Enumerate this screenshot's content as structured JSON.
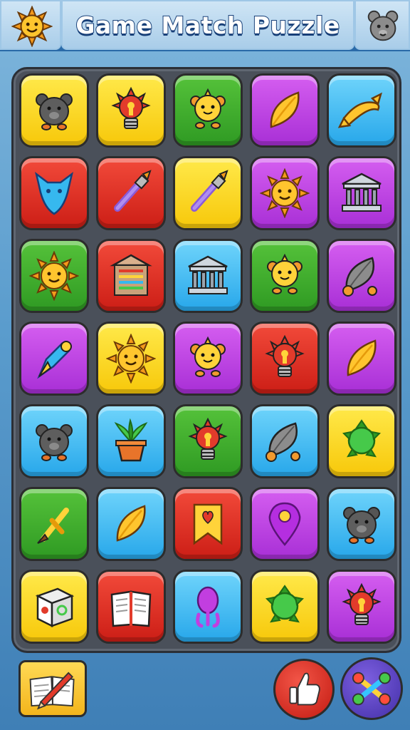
{
  "header": {
    "title": "Game Match Puzzle",
    "left_icon": "sun-face-icon",
    "right_icon": "bear-face-icon"
  },
  "board": {
    "rows": 7,
    "columns": 5,
    "tiles": [
      [
        {
          "color": "yellow",
          "icon": "bear-icon"
        },
        {
          "color": "yellow",
          "icon": "lightbulb-icon"
        },
        {
          "color": "green",
          "icon": "critter-icon"
        },
        {
          "color": "purple",
          "icon": "leaf-icon"
        },
        {
          "color": "blue",
          "icon": "ribbon-icon"
        }
      ],
      [
        {
          "color": "red",
          "icon": "fox-head-icon"
        },
        {
          "color": "red",
          "icon": "brush-icon"
        },
        {
          "color": "yellow",
          "icon": "brush-icon"
        },
        {
          "color": "purple",
          "icon": "sun-icon"
        },
        {
          "color": "purple",
          "icon": "temple-icon"
        }
      ],
      [
        {
          "color": "green",
          "icon": "sun-icon"
        },
        {
          "color": "red",
          "icon": "abacus-temple-icon"
        },
        {
          "color": "blue",
          "icon": "temple-icon"
        },
        {
          "color": "green",
          "icon": "critter-icon"
        },
        {
          "color": "purple",
          "icon": "feather-icon"
        }
      ],
      [
        {
          "color": "purple",
          "icon": "pen-nib-icon"
        },
        {
          "color": "yellow",
          "icon": "sun-icon"
        },
        {
          "color": "purple",
          "icon": "critter-icon"
        },
        {
          "color": "red",
          "icon": "lightbulb-icon"
        },
        {
          "color": "purple",
          "icon": "leaf-icon"
        }
      ],
      [
        {
          "color": "blue",
          "icon": "bear-icon"
        },
        {
          "color": "blue",
          "icon": "potted-plant-icon"
        },
        {
          "color": "green",
          "icon": "lightbulb-icon"
        },
        {
          "color": "blue",
          "icon": "feather-icon"
        },
        {
          "color": "yellow",
          "icon": "turtle-icon"
        }
      ],
      [
        {
          "color": "green",
          "icon": "sword-icon"
        },
        {
          "color": "blue",
          "icon": "leaf-icon"
        },
        {
          "color": "red",
          "icon": "bookmark-icon"
        },
        {
          "color": "purple",
          "icon": "map-pin-icon"
        },
        {
          "color": "blue",
          "icon": "bear-icon"
        }
      ],
      [
        {
          "color": "yellow",
          "icon": "dice-icon"
        },
        {
          "color": "red",
          "icon": "open-book-icon"
        },
        {
          "color": "blue",
          "icon": "balloon-icon"
        },
        {
          "color": "yellow",
          "icon": "turtle-icon"
        },
        {
          "color": "purple",
          "icon": "lightbulb-icon"
        }
      ]
    ]
  },
  "controls": {
    "book_button_icon": "book-pencil-icon",
    "like_button_icon": "thumbs-up-icon",
    "shuffle_button_icon": "shuffle-icon"
  },
  "colors": {
    "yellow": "#f7c80a",
    "green": "#2f9a23",
    "purple": "#a82fd6",
    "blue": "#27a7ea",
    "red": "#cc1e16"
  }
}
